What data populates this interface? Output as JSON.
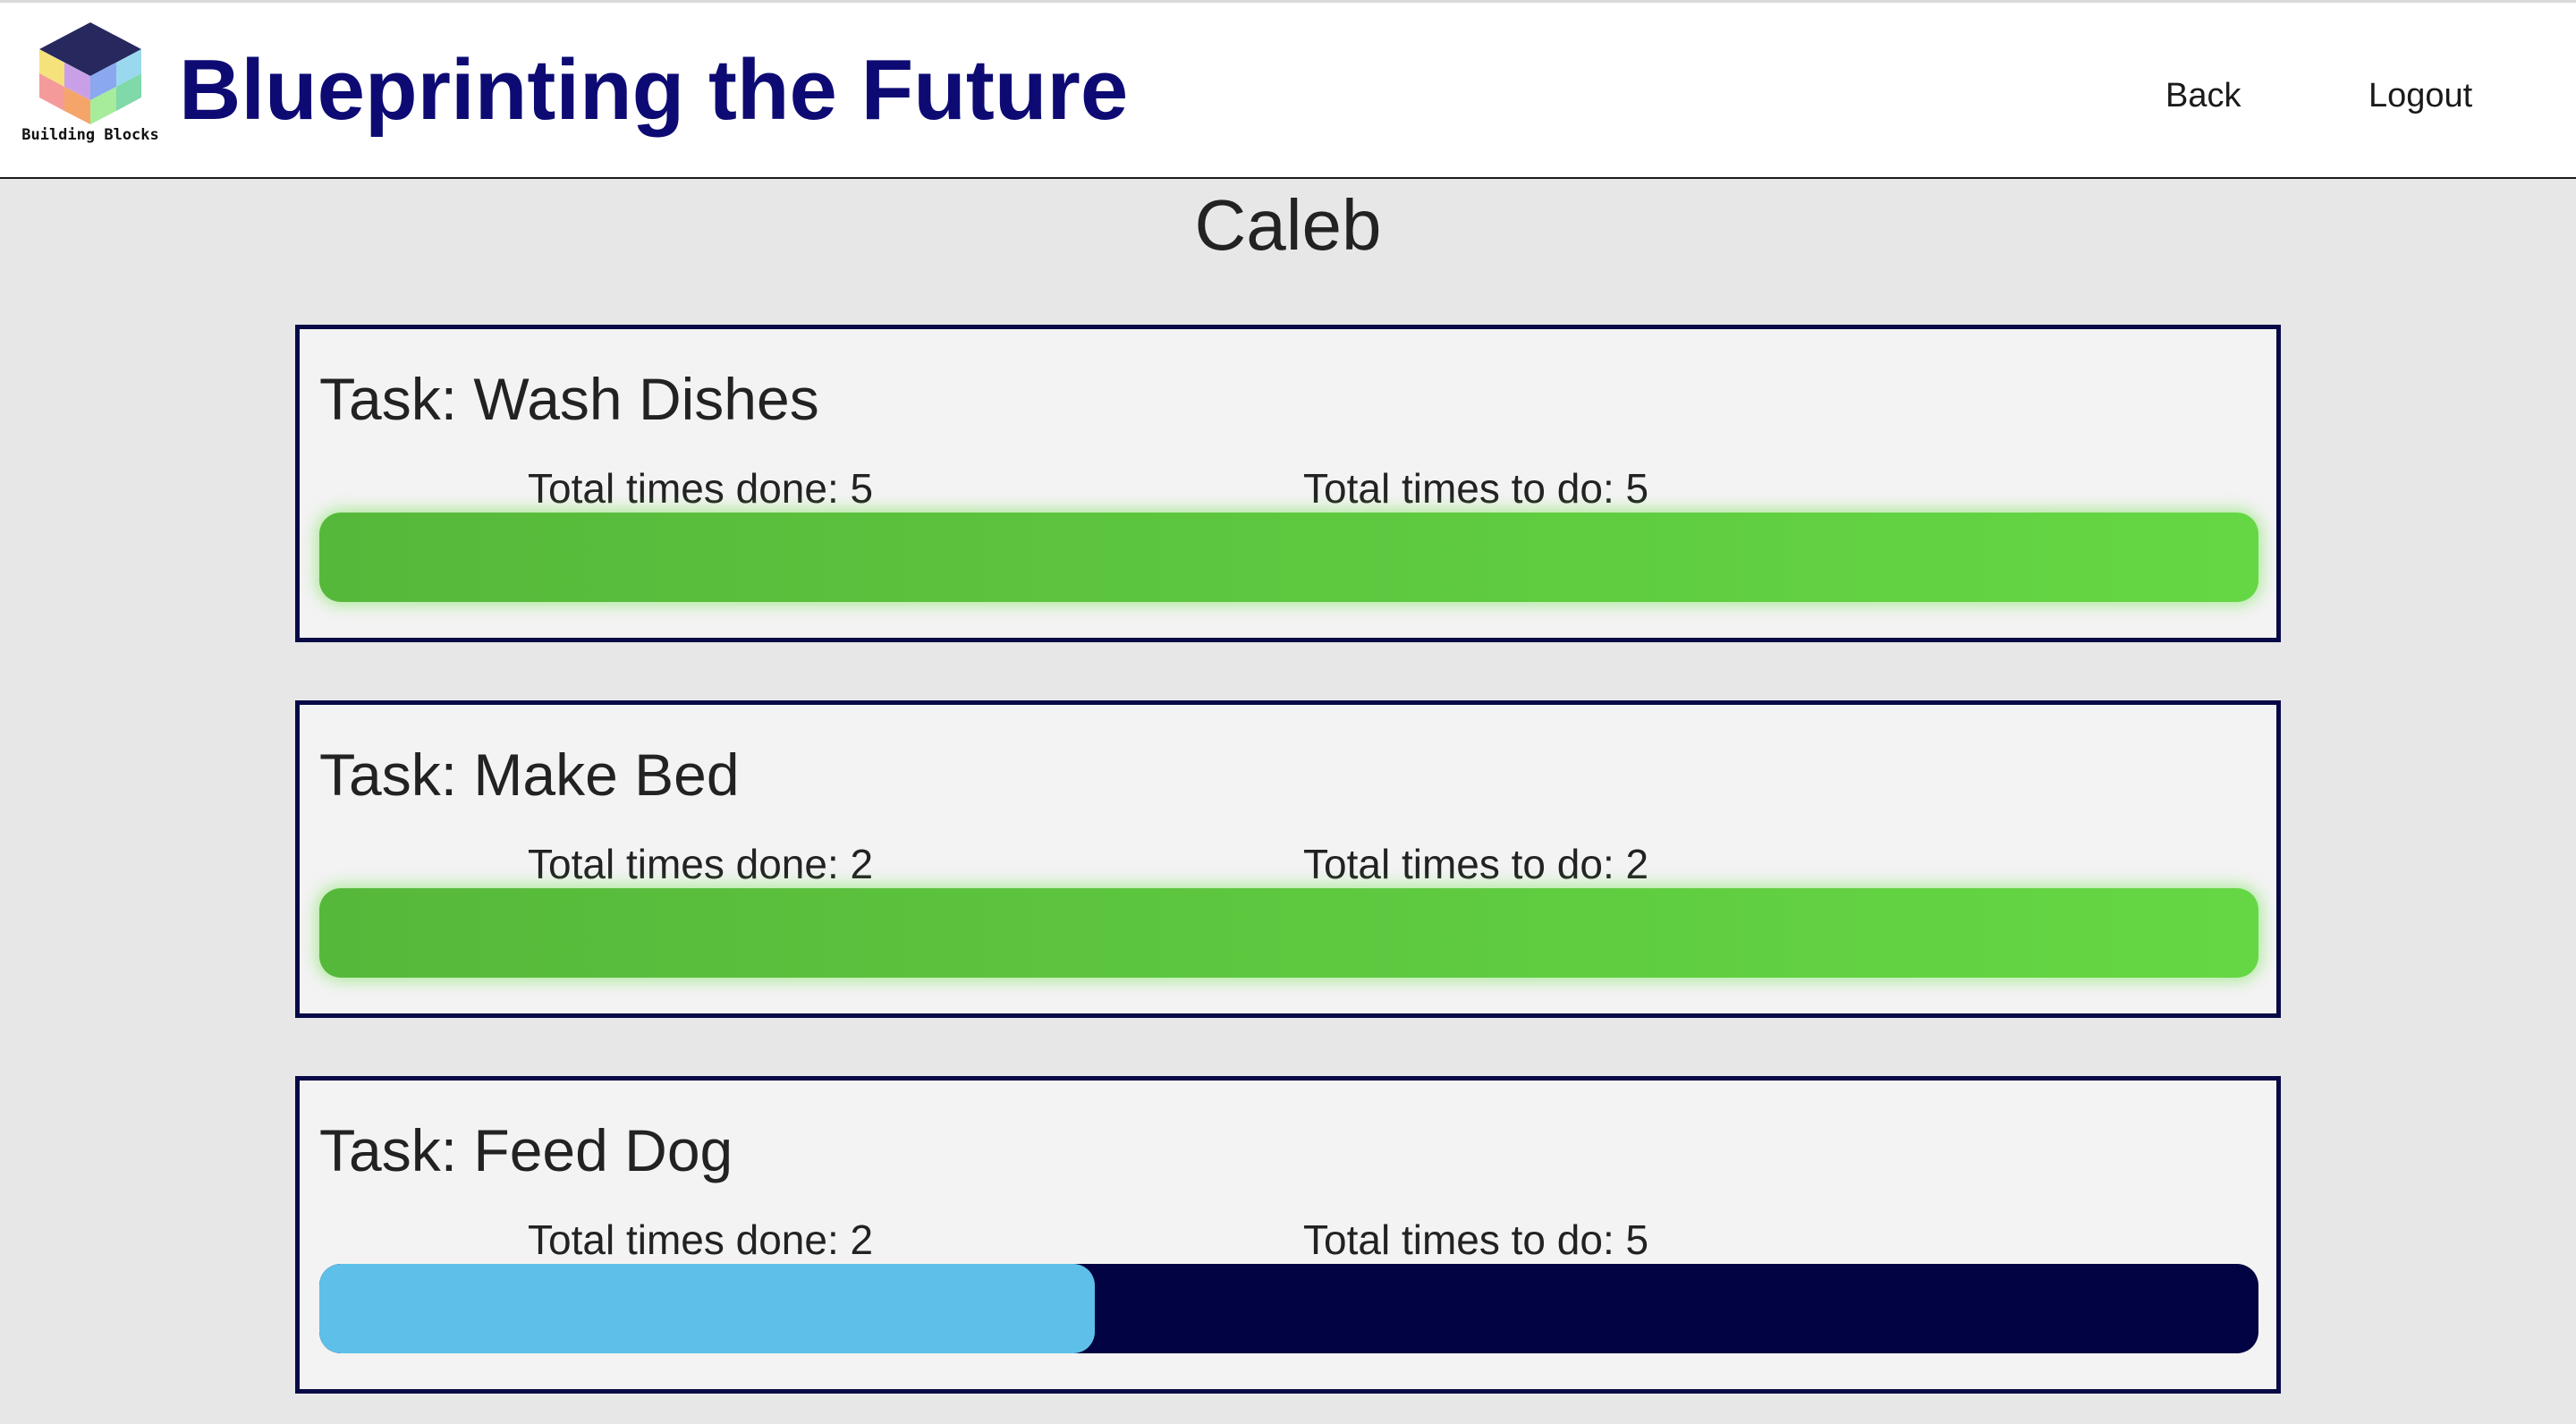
{
  "header": {
    "logo_text": "Building Blocks",
    "title": "Blueprinting the Future",
    "nav": {
      "back": "Back",
      "logout": "Logout"
    }
  },
  "child_name": "Caleb",
  "tasks": [
    {
      "title": "Task: Wash Dishes",
      "done_label": "Total times done: 5",
      "todo_label": "Total times to do: 5",
      "done": 5,
      "total": 5,
      "progress": 1.0
    },
    {
      "title": "Task: Make Bed",
      "done_label": "Total times done: 2",
      "todo_label": "Total times to do: 2",
      "done": 2,
      "total": 2,
      "progress": 1.0
    },
    {
      "title": "Task: Feed Dog",
      "done_label": "Total times done: 2",
      "todo_label": "Total times to do: 5",
      "done": 2,
      "total": 5,
      "progress": 0.4
    }
  ],
  "colors": {
    "brand": "#0d0b73",
    "card_border": "#070a47",
    "complete_fill": "#5fcc40",
    "partial_fill": "#5ec0e8",
    "track": "#020342"
  }
}
